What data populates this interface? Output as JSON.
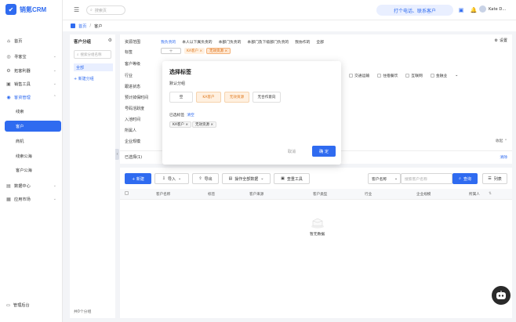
{
  "app": {
    "name": "销氪CRM"
  },
  "header": {
    "search_placeholder": "搜索页",
    "call_button": "打个电话、联系客户",
    "user_name": "Kate D..."
  },
  "breadcrumb": [
    "首页",
    "/",
    "客户"
  ],
  "sidebar": {
    "items": [
      {
        "label": "首页",
        "icon": "home-icon",
        "arrow": ""
      },
      {
        "label": "寻客宝",
        "icon": "radar-icon",
        "arrow": "⌄"
      },
      {
        "label": "拓客利器",
        "icon": "tool-icon",
        "arrow": "⌄"
      },
      {
        "label": "销售工具",
        "icon": "briefcase-icon",
        "arrow": "⌄"
      },
      {
        "label": "客资管理",
        "icon": "customer-icon",
        "arrow": "⌃"
      }
    ],
    "sub_items": [
      "线索",
      "客户",
      "商机",
      "线索公海",
      "客户公海"
    ],
    "items_bottom": [
      {
        "label": "数据中心",
        "icon": "chart-icon",
        "arrow": "⌄"
      },
      {
        "label": "应用市场",
        "icon": "grid-icon",
        "arrow": "⌄"
      }
    ],
    "management": "管理后台"
  },
  "group_panel": {
    "title": "客户分组",
    "search_placeholder": "搜索分组名称",
    "all": "全部",
    "new_group": "+ 新建分组",
    "count": "共0个分组"
  },
  "filter": {
    "labels": [
      "资源范围",
      "标签",
      "客户等级",
      "行业",
      "跟进状态",
      "预计掉保时间",
      "号码活跃度",
      "入池时间",
      "所属人",
      "企业规模"
    ],
    "tabs": [
      "我负责的",
      "本人以下属负责的",
      "本部门负责的",
      "本部门及下级部门负责的",
      "我协作的",
      "全部"
    ],
    "settings": "设置",
    "tag_chips": [
      "KA客户 ×",
      "无效资源 ×"
    ],
    "checkboxes": [
      "交通运输",
      "住宿餐饮",
      "互联网",
      "金融业"
    ],
    "collapse": "收起",
    "selected": "已选择(1)",
    "clear": "清除"
  },
  "modal": {
    "title": "选择标签",
    "default_group": "默认分组",
    "options": [
      "空",
      "KA客户",
      "无效资源",
      "无合作意向"
    ],
    "selected_label": "已选标签",
    "clear": "清空",
    "selected_chips": [
      "KA客户 ×",
      "无效资源 ×"
    ],
    "cancel": "取消",
    "confirm": "确 定"
  },
  "list": {
    "new": "+ 新建",
    "import": "导入",
    "export": "导出",
    "operate_all": "操作全部数据",
    "dedup": "查重工具",
    "field_select": "客户名称",
    "search_placeholder": "搜索客户名称",
    "query": "查询",
    "columns_btn": "列表",
    "columns": [
      "客户名称",
      "标签",
      "客户来源",
      "客户类型",
      "行业",
      "企业规模",
      "所属人"
    ],
    "empty": "暂无数据"
  }
}
